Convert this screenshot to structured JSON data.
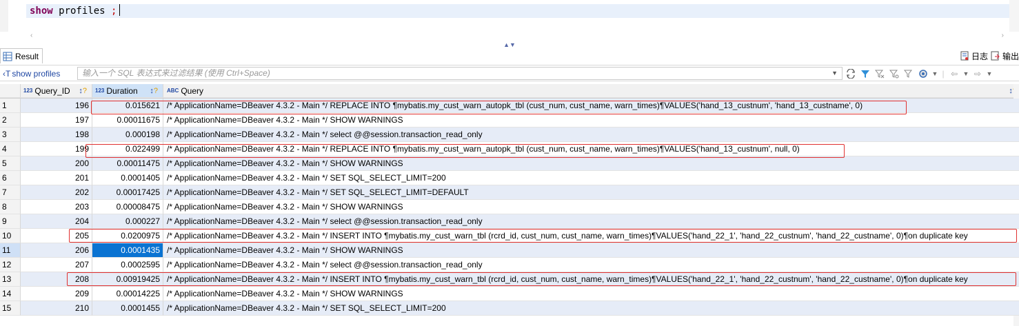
{
  "editor": {
    "keyword": "show",
    "rest": " profiles ",
    "semicolon": ";"
  },
  "scroll": {
    "left_arrow": "‹",
    "right_arrow": "›"
  },
  "splitter": {
    "arrows": "▲▼"
  },
  "tab": {
    "label": "Result"
  },
  "toolbar_right": {
    "log_label": "日志",
    "export_label": "输出"
  },
  "filter": {
    "label_icon": "‹T",
    "label": "show profiles",
    "placeholder": "输入一个 SQL 表达式来过滤结果 (使用 Ctrl+Space)"
  },
  "columns": [
    {
      "type": "123",
      "name": "Query_ID"
    },
    {
      "type": "123",
      "name": "Duration"
    },
    {
      "type": "ABC",
      "name": "Query"
    }
  ],
  "rows": [
    {
      "n": "1",
      "id": "196",
      "dur": "0.015621",
      "q": "/* ApplicationName=DBeaver 4.3.2 - Main */ REPLACE INTO  ¶mybatis.my_cust_warn_autopk_tbl (cust_num, cust_name, warn_times)¶VALUES('hand_13_custnum', 'hand_13_custname', 0)"
    },
    {
      "n": "2",
      "id": "197",
      "dur": "0.00011675",
      "q": "/* ApplicationName=DBeaver 4.3.2 - Main */ SHOW WARNINGS"
    },
    {
      "n": "3",
      "id": "198",
      "dur": "0.000198",
      "q": "/* ApplicationName=DBeaver 4.3.2 - Main */ select @@session.transaction_read_only"
    },
    {
      "n": "4",
      "id": "199",
      "dur": "0.022499",
      "q": "/* ApplicationName=DBeaver 4.3.2 - Main */ REPLACE INTO  ¶mybatis.my_cust_warn_autopk_tbl (cust_num, cust_name, warn_times)¶VALUES('hand_13_custnum', null, 0)"
    },
    {
      "n": "5",
      "id": "200",
      "dur": "0.00011475",
      "q": "/* ApplicationName=DBeaver 4.3.2 - Main */ SHOW WARNINGS"
    },
    {
      "n": "6",
      "id": "201",
      "dur": "0.0001405",
      "q": "/* ApplicationName=DBeaver 4.3.2 - Main */ SET SQL_SELECT_LIMIT=200"
    },
    {
      "n": "7",
      "id": "202",
      "dur": "0.00017425",
      "q": "/* ApplicationName=DBeaver 4.3.2 - Main */ SET SQL_SELECT_LIMIT=DEFAULT"
    },
    {
      "n": "8",
      "id": "203",
      "dur": "0.00008475",
      "q": "/* ApplicationName=DBeaver 4.3.2 - Main */ SHOW WARNINGS"
    },
    {
      "n": "9",
      "id": "204",
      "dur": "0.000227",
      "q": "/* ApplicationName=DBeaver 4.3.2 - Main */ select @@session.transaction_read_only"
    },
    {
      "n": "10",
      "id": "205",
      "dur": "0.0200975",
      "q": "/* ApplicationName=DBeaver 4.3.2 - Main */ INSERT INTO  ¶mybatis.my_cust_warn_tbl (rcrd_id, cust_num, cust_name, warn_times)¶VALUES('hand_22_1', 'hand_22_custnum', 'hand_22_custname', 0)¶on duplicate key"
    },
    {
      "n": "11",
      "id": "206",
      "dur": "0.0001435",
      "q": "/* ApplicationName=DBeaver 4.3.2 - Main */ SHOW WARNINGS"
    },
    {
      "n": "12",
      "id": "207",
      "dur": "0.0002595",
      "q": "/* ApplicationName=DBeaver 4.3.2 - Main */ select @@session.transaction_read_only"
    },
    {
      "n": "13",
      "id": "208",
      "dur": "0.00919425",
      "q": "/* ApplicationName=DBeaver 4.3.2 - Main */ INSERT INTO  ¶mybatis.my_cust_warn_tbl (rcrd_id, cust_num, cust_name, warn_times)¶VALUES('hand_22_1', 'hand_22_custnum', 'hand_22_custname', 0)¶on duplicate key"
    },
    {
      "n": "14",
      "id": "209",
      "dur": "0.00014225",
      "q": "/* ApplicationName=DBeaver 4.3.2 - Main */ SHOW WARNINGS"
    },
    {
      "n": "15",
      "id": "210",
      "dur": "0.0001455",
      "q": "/* ApplicationName=DBeaver 4.3.2 - Main */ SET SQL_SELECT_LIMIT=200"
    }
  ],
  "selected_row": "11",
  "colors": {
    "accent": "#0a73d2",
    "highlight_border": "#e03030",
    "odd_row": "#e6ecf7"
  }
}
